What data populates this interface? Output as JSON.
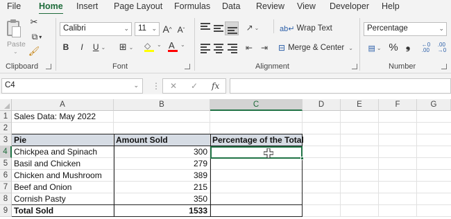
{
  "menu": {
    "tabs": [
      {
        "label": "File"
      },
      {
        "label": "Home"
      },
      {
        "label": "Insert"
      },
      {
        "label": "Page Layout"
      },
      {
        "label": "Formulas"
      },
      {
        "label": "Data"
      },
      {
        "label": "Review"
      },
      {
        "label": "View"
      },
      {
        "label": "Developer"
      },
      {
        "label": "Help"
      }
    ],
    "active_index": 1
  },
  "ribbon": {
    "clipboard": {
      "label": "Clipboard",
      "paste_label": "Paste"
    },
    "font": {
      "label": "Font",
      "font_name": "Calibri",
      "font_size": "11",
      "bold": "B",
      "italic": "I",
      "underline": "U",
      "grow": "A",
      "shrink": "A",
      "font_color_letter": "A",
      "highlight_color": "#ffff00",
      "font_color": "#ff0000"
    },
    "alignment": {
      "label": "Alignment",
      "wrap_text": "Wrap Text",
      "merge_center": "Merge & Center"
    },
    "number": {
      "label": "Number",
      "format": "Percentage",
      "percent": "%",
      "comma": "❟"
    }
  },
  "formula_bar": {
    "name_box": "C4",
    "fx": "fx",
    "formula": ""
  },
  "sheet": {
    "columns": [
      "A",
      "B",
      "C",
      "D",
      "E",
      "F",
      "G"
    ],
    "selected_column": "C",
    "rows": [
      "1",
      "2",
      "3",
      "4",
      "5",
      "6",
      "7",
      "8",
      "9"
    ],
    "selected_row": "4",
    "title": "Sales Data: May 2022",
    "headers": [
      "Pie",
      "Amount Sold",
      "Percentage of the Total"
    ],
    "data": [
      {
        "pie": "Chickpea and Spinach",
        "amount": "300",
        "pct": ""
      },
      {
        "pie": "Basil and Chicken",
        "amount": "279",
        "pct": ""
      },
      {
        "pie": "Chicken and Mushroom",
        "amount": "389",
        "pct": ""
      },
      {
        "pie": "Beef and Onion",
        "amount": "215",
        "pct": ""
      },
      {
        "pie": "Cornish Pasty",
        "amount": "350",
        "pct": ""
      }
    ],
    "total": {
      "label": "Total Sold",
      "amount": "1533"
    },
    "header_fill": "#d6dce4",
    "selection_color": "#217346"
  }
}
